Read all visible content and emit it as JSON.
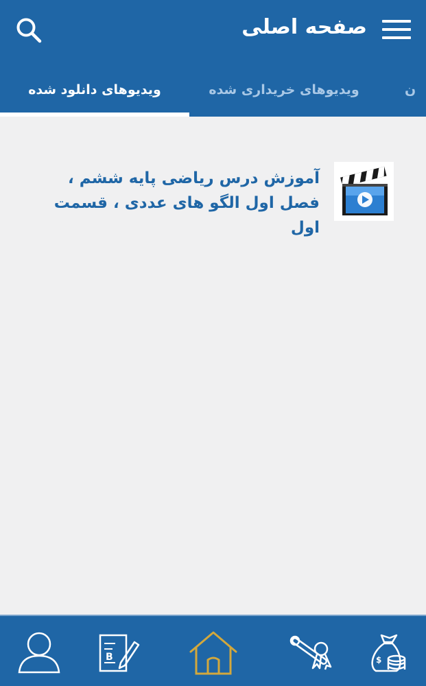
{
  "header": {
    "title": "صفحه اصلی"
  },
  "tabs": [
    {
      "label": "ویدیوهای دانلود شده",
      "active": true
    },
    {
      "label": "ویدیوهای خریداری شده",
      "active": false
    },
    {
      "label": "ن",
      "active": false
    }
  ],
  "videos": [
    {
      "title": "آموزش درس ریاضی پایه ششم ، فصل اول الگو های عددی ، قسمت اول"
    }
  ],
  "bottom_nav": [
    {
      "icon": "user-icon"
    },
    {
      "icon": "edit-document-icon"
    },
    {
      "icon": "home-icon",
      "active": true
    },
    {
      "icon": "diploma-icon"
    },
    {
      "icon": "money-bag-icon"
    }
  ],
  "colors": {
    "primary": "#1f66a6",
    "background": "#f0f0f1",
    "active_icon": "#d3a83c",
    "inactive_tab": "#a9c8e6",
    "title_text": "#1f66a6"
  }
}
